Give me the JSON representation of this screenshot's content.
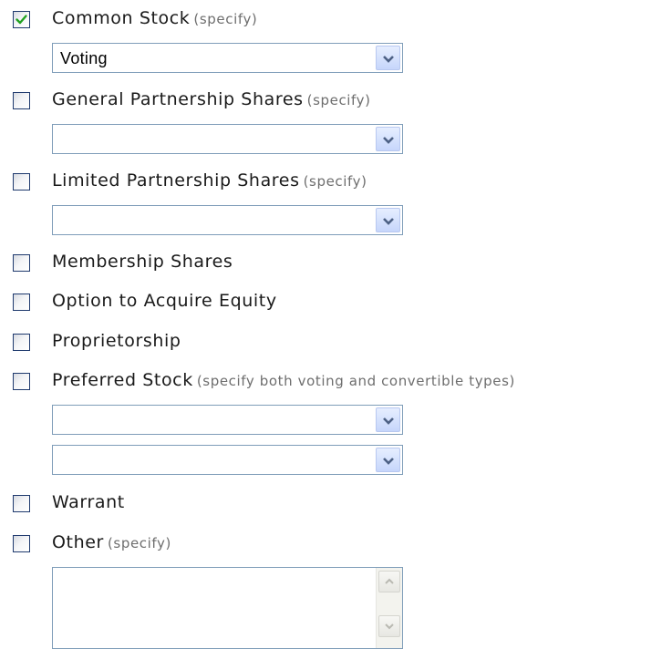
{
  "options": [
    {
      "label": "Common Stock",
      "hint": "(specify)",
      "checked": true
    },
    {
      "label": "General Partnership Shares",
      "hint": "(specify)",
      "checked": false
    },
    {
      "label": "Limited Partnership Shares",
      "hint": "(specify)",
      "checked": false
    },
    {
      "label": "Membership Shares",
      "hint": "",
      "checked": false
    },
    {
      "label": "Option to Acquire Equity",
      "hint": "",
      "checked": false
    },
    {
      "label": "Proprietorship",
      "hint": "",
      "checked": false
    },
    {
      "label": "Preferred Stock",
      "hint": "(specify both voting and convertible types)",
      "checked": false
    },
    {
      "label": "Warrant",
      "hint": "",
      "checked": false
    },
    {
      "label": "Other",
      "hint": "(specify)",
      "checked": false
    }
  ],
  "selects": {
    "common_stock": "Voting",
    "general_partnership": "",
    "limited_partnership": "",
    "preferred_voting": "",
    "preferred_convertible": ""
  },
  "other_text": "",
  "icons": {
    "checkbox_check": "check-mark-icon",
    "dropdown_arrow": "chevron-down-icon",
    "scroll_up": "scroll-up-arrow-icon",
    "scroll_down": "scroll-down-arrow-icon"
  },
  "colors": {
    "checkbox_border": "#1f3a6e",
    "check_mark": "#21a121",
    "select_border": "#7f9db9",
    "dropdown_button": "#c6d6fb",
    "hint_text": "#6e6e6e"
  }
}
